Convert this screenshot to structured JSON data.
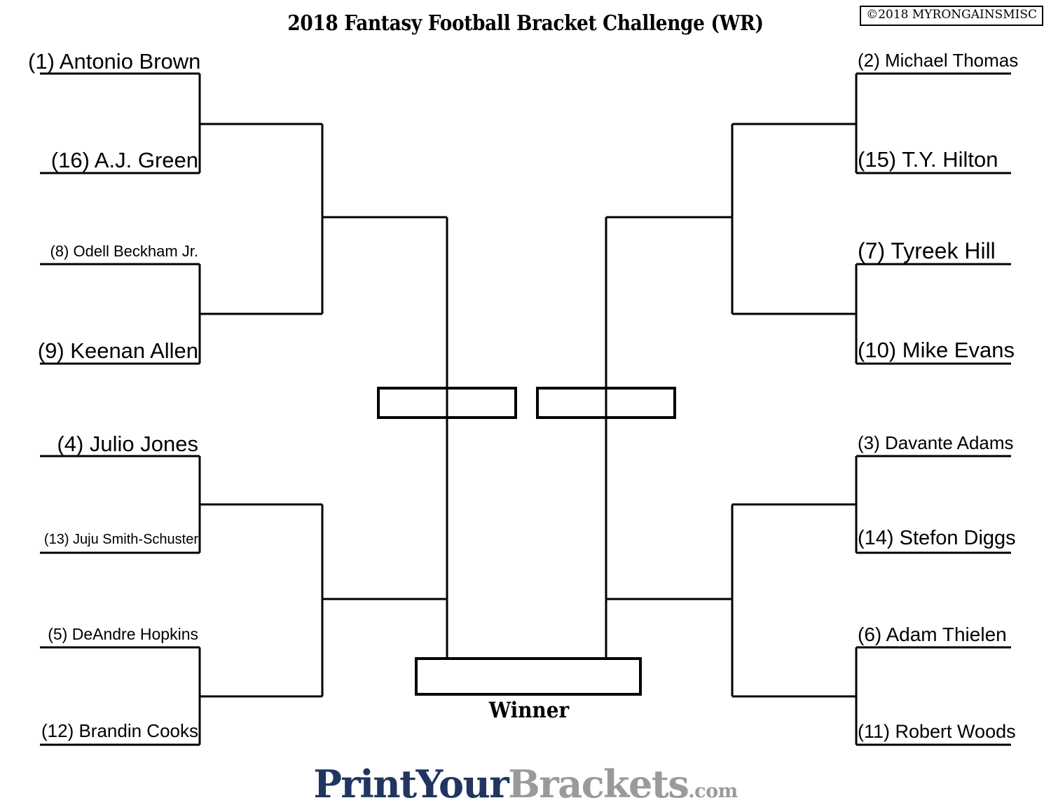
{
  "header": {
    "title": "2018 Fantasy Football Bracket Challenge (WR)",
    "copyright": "©2018 MYRONGAINSMISC"
  },
  "bracket": {
    "winner_caption": "Winner",
    "line_color": "#000000",
    "background_color": "#ffffff",
    "left_seeds": [
      {
        "label": "(1) Antonio Brown",
        "seed": 1,
        "name": "Antonio Brown"
      },
      {
        "label": "(16) A.J. Green",
        "seed": 16,
        "name": "A.J. Green"
      },
      {
        "label": "(8) Odell Beckham Jr.",
        "seed": 8,
        "name": "Odell Beckham Jr."
      },
      {
        "label": "(9) Keenan Allen",
        "seed": 9,
        "name": "Keenan Allen"
      },
      {
        "label": "(4) Julio Jones",
        "seed": 4,
        "name": "Julio Jones"
      },
      {
        "label": "(13) Juju Smith-Schuster",
        "seed": 13,
        "name": "Juju Smith-Schuster"
      },
      {
        "label": "(5) DeAndre Hopkins",
        "seed": 5,
        "name": "DeAndre Hopkins"
      },
      {
        "label": "(12) Brandin Cooks",
        "seed": 12,
        "name": "Brandin Cooks"
      }
    ],
    "right_seeds": [
      {
        "label": "(2) Michael Thomas",
        "seed": 2,
        "name": "Michael Thomas"
      },
      {
        "label": "(15) T.Y. Hilton",
        "seed": 15,
        "name": "T.Y. Hilton"
      },
      {
        "label": "(7) Tyreek Hill",
        "seed": 7,
        "name": "Tyreek Hill"
      },
      {
        "label": "(10) Mike Evans",
        "seed": 10,
        "name": "Mike Evans"
      },
      {
        "label": "(3) Davante Adams",
        "seed": 3,
        "name": "Davante Adams"
      },
      {
        "label": "(14) Stefon Diggs",
        "seed": 14,
        "name": "Stefon Diggs"
      },
      {
        "label": "(6) Adam Thielen",
        "seed": 6,
        "name": "Adam Thielen"
      },
      {
        "label": "(11) Robert Woods",
        "seed": 11,
        "name": "Robert Woods"
      }
    ],
    "semifinal_slots": [
      "",
      ""
    ],
    "final_slot": ""
  },
  "footer": {
    "logo_primary": "PrintYour",
    "logo_secondary": "Brackets",
    "logo_tld": ".com",
    "primary_color": "#20355f",
    "secondary_color": "#9a9a9a"
  }
}
